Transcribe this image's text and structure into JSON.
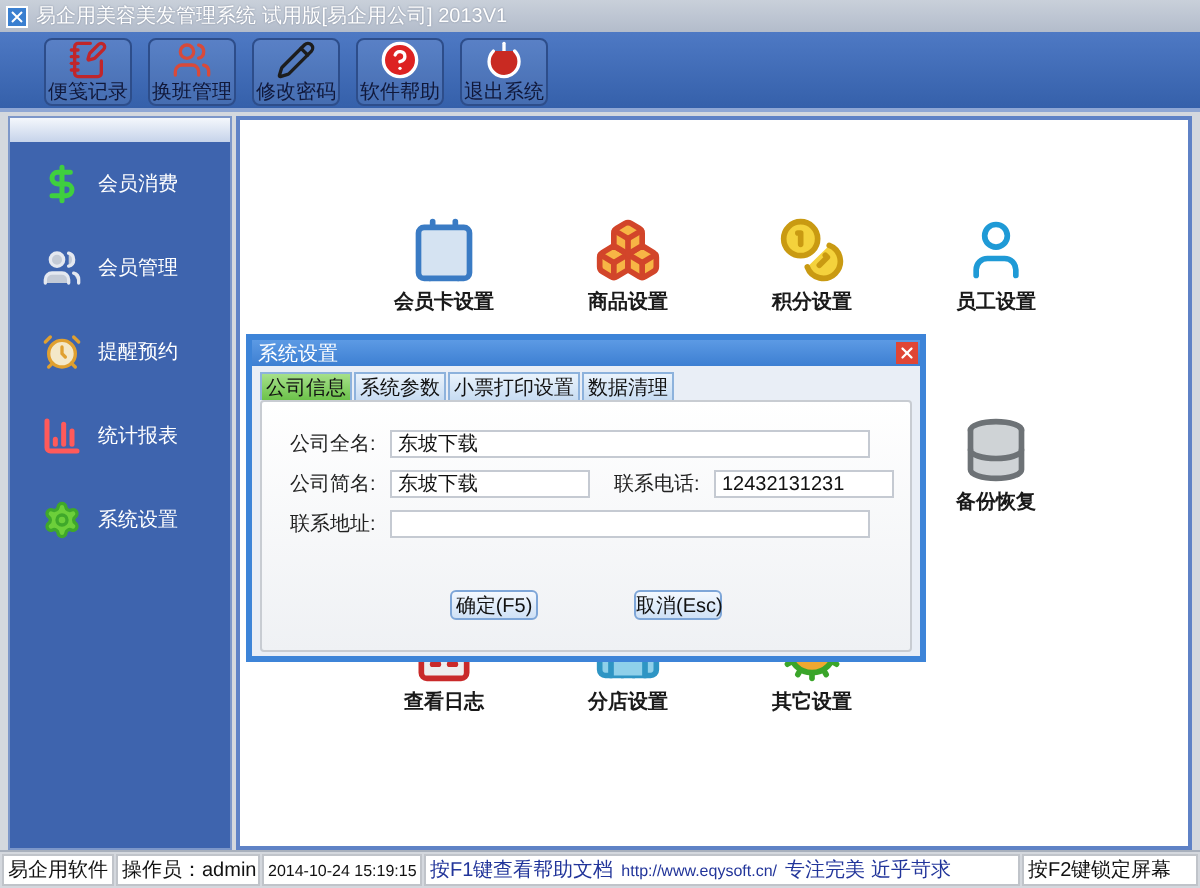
{
  "window": {
    "title": "易企用美容美发管理系统 试用版[易企用公司] 2013V1"
  },
  "toolbar": [
    {
      "label": "便笺记录",
      "kind": "note"
    },
    {
      "label": "换班管理",
      "kind": "shift"
    },
    {
      "label": "修改密码",
      "kind": "password"
    },
    {
      "label": "软件帮助",
      "kind": "help"
    },
    {
      "label": "退出系统",
      "kind": "exit"
    }
  ],
  "sidebar": {
    "items": [
      {
        "label": "会员消费",
        "kind": "money"
      },
      {
        "label": "会员管理",
        "kind": "members"
      },
      {
        "label": "提醒预约",
        "kind": "clock"
      },
      {
        "label": "统计报表",
        "kind": "chart"
      },
      {
        "label": "系统设置",
        "kind": "settings"
      }
    ]
  },
  "modules": [
    {
      "label": "会员卡设置",
      "kind": "card"
    },
    {
      "label": "商品设置",
      "kind": "boxes"
    },
    {
      "label": "积分设置",
      "kind": "coin"
    },
    {
      "label": "员工设置",
      "kind": "staff"
    },
    {
      "label": "备份恢复",
      "kind": "backup"
    },
    {
      "label": "查看日志",
      "kind": "log"
    },
    {
      "label": "分店设置",
      "kind": "branch"
    },
    {
      "label": "其它设置",
      "kind": "gears"
    }
  ],
  "dialog": {
    "title": "系统设置",
    "tabs": [
      {
        "label": "公司信息",
        "selected": true
      },
      {
        "label": "系统参数",
        "selected": false
      },
      {
        "label": "小票打印设置",
        "selected": false
      },
      {
        "label": "数据清理",
        "selected": false
      }
    ],
    "fields": [
      {
        "label": "公司全名:",
        "value": "东坡下载"
      },
      {
        "label": "公司简名:",
        "value": "东坡下载"
      },
      {
        "label": "联系电话:",
        "value": "12432131231"
      },
      {
        "label": "联系地址:"
      }
    ],
    "buttons": [
      "确定(F5)",
      "取消(Esc)"
    ]
  },
  "status_bar": {
    "company": "易企用软件",
    "operator": "操作员：admin",
    "time": "2014-10-24 15:19:15",
    "help": "按F1键查看帮助文档",
    "link": "http://www.eqysoft.cn/",
    "slogan": "专注完美 近乎苛求",
    "lock": "按F2键锁定屏幕"
  }
}
